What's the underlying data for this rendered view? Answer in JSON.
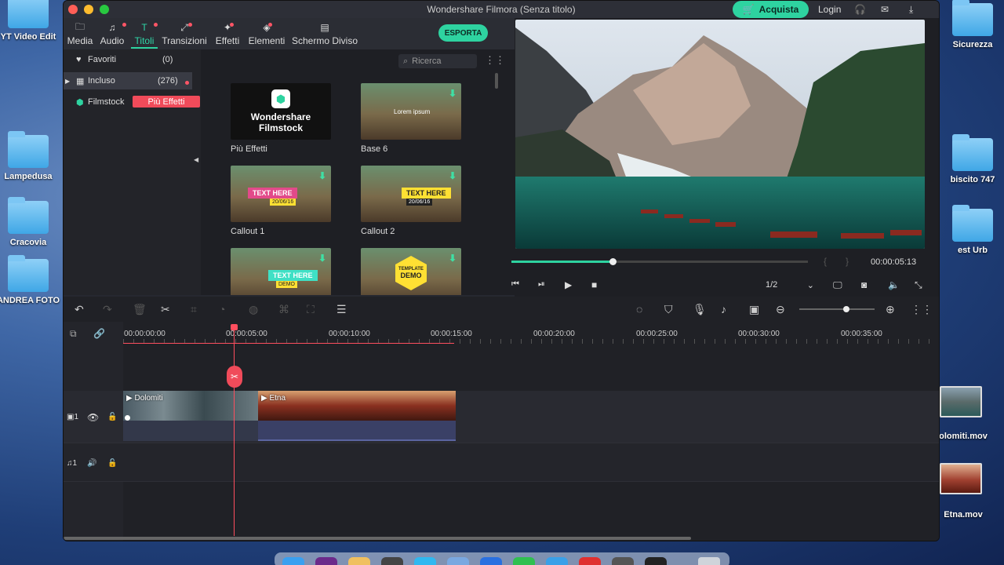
{
  "window_title": "Wondershare Filmora (Senza titolo)",
  "topbar": {
    "buy_label": "Acquista",
    "login_label": "Login"
  },
  "tabs": [
    {
      "label": "Media"
    },
    {
      "label": "Audio"
    },
    {
      "label": "Titoli"
    },
    {
      "label": "Transizioni"
    },
    {
      "label": "Effetti"
    },
    {
      "label": "Elementi"
    },
    {
      "label": "Schermo Diviso"
    }
  ],
  "export_label": "ESPORTA",
  "library": {
    "favorites_label": "Favoriti",
    "favorites_count": "(0)",
    "included_label": "Incluso",
    "included_count": "(276)",
    "filmstock_label": "Filmstock",
    "more_effects_pill": "Più Effetti",
    "search_placeholder": "Ricerca"
  },
  "cards": [
    {
      "label": "Più Effetti",
      "line1": "Wondershare",
      "line2": "Filmstock"
    },
    {
      "label": "Base 6",
      "overlay": "Lorem ipsum"
    },
    {
      "label": "Callout 1",
      "overlay": "TEXT HERE",
      "sub": "20/06/16"
    },
    {
      "label": "Callout 2",
      "overlay": "TEXT HERE",
      "sub": "20/06/16"
    },
    {
      "overlay": "TEXT HERE",
      "sub": "DEMO"
    },
    {
      "overlay": "TEMPLATE",
      "sub": "DEMO"
    }
  ],
  "player": {
    "timecode": "00:00:05:13",
    "quality": "1/2",
    "progress": 0.34
  },
  "ruler": [
    "00:00:00:00",
    "00:00:05:00",
    "00:00:10:00",
    "00:00:15:00",
    "00:00:20:00",
    "00:00:25:00",
    "00:00:30:00",
    "00:00:35:00"
  ],
  "clips": [
    {
      "name": "Dolomiti"
    },
    {
      "name": "Etna"
    }
  ],
  "tracks": {
    "video_num": "1",
    "audio_num": "1"
  },
  "desktop": {
    "left": [
      "YT Video Edit",
      "Lampedusa",
      "Cracovia",
      "ANDREA FOTO"
    ],
    "right": [
      "Sicurezza",
      "biscito 747",
      "est Urb",
      "olomiti.mov",
      "Etna.mov"
    ]
  },
  "colors": {
    "accent": "#2ed3a0",
    "playhead": "#ff4e5e",
    "pill": "#f04b5a"
  }
}
